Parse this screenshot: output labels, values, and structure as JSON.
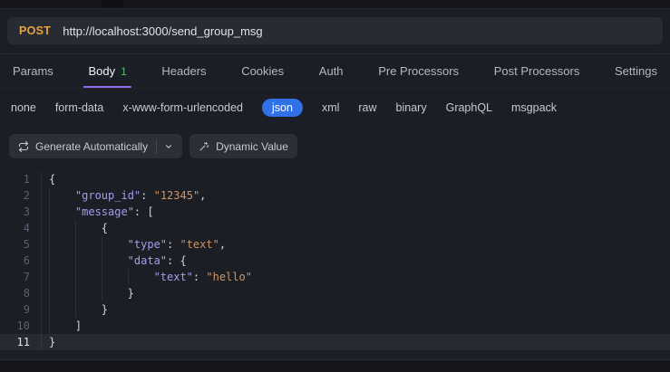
{
  "request": {
    "method": "POST",
    "url": "http://localhost:3000/send_group_msg"
  },
  "tabs": [
    {
      "label": "Params"
    },
    {
      "label": "Body",
      "badge": "1",
      "active": true
    },
    {
      "label": "Headers"
    },
    {
      "label": "Cookies"
    },
    {
      "label": "Auth"
    },
    {
      "label": "Pre Processors"
    },
    {
      "label": "Post Processors"
    },
    {
      "label": "Settings"
    }
  ],
  "body_types": [
    "none",
    "form-data",
    "x-www-form-urlencoded",
    "json",
    "xml",
    "raw",
    "binary",
    "GraphQL",
    "msgpack"
  ],
  "selected_body_type": "json",
  "toolbar": {
    "generate_label": "Generate Automatically",
    "dynamic_value_label": "Dynamic Value"
  },
  "editor": {
    "active_line": 11,
    "lines": [
      {
        "n": 1,
        "indent": 0,
        "tokens": [
          [
            "p",
            "{"
          ]
        ]
      },
      {
        "n": 2,
        "indent": 1,
        "tokens": [
          [
            "k",
            "\"group_id\""
          ],
          [
            "p",
            ": "
          ],
          [
            "s",
            "\"12345\""
          ],
          [
            "p",
            ","
          ]
        ]
      },
      {
        "n": 3,
        "indent": 1,
        "tokens": [
          [
            "k",
            "\"message\""
          ],
          [
            "p",
            ": ["
          ]
        ]
      },
      {
        "n": 4,
        "indent": 2,
        "tokens": [
          [
            "p",
            "{"
          ]
        ]
      },
      {
        "n": 5,
        "indent": 3,
        "tokens": [
          [
            "k",
            "\"type\""
          ],
          [
            "p",
            ": "
          ],
          [
            "s",
            "\"text\""
          ],
          [
            "p",
            ","
          ]
        ]
      },
      {
        "n": 6,
        "indent": 3,
        "tokens": [
          [
            "k",
            "\"data\""
          ],
          [
            "p",
            ": {"
          ]
        ]
      },
      {
        "n": 7,
        "indent": 4,
        "tokens": [
          [
            "k",
            "\"text\""
          ],
          [
            "p",
            ": "
          ],
          [
            "s",
            "\"hello\""
          ]
        ]
      },
      {
        "n": 8,
        "indent": 3,
        "tokens": [
          [
            "p",
            "}"
          ]
        ]
      },
      {
        "n": 9,
        "indent": 2,
        "tokens": [
          [
            "p",
            "}"
          ]
        ]
      },
      {
        "n": 10,
        "indent": 1,
        "tokens": [
          [
            "p",
            "]"
          ]
        ]
      },
      {
        "n": 11,
        "indent": 0,
        "tokens": [
          [
            "p",
            "}"
          ]
        ]
      }
    ]
  },
  "colors": {
    "method": "#e8a33d",
    "accent_underline": "#8d6bf2",
    "badge": "#4fc173",
    "selected_pill": "#3071e8",
    "json_key": "#a49df0",
    "json_string": "#cf9566"
  }
}
